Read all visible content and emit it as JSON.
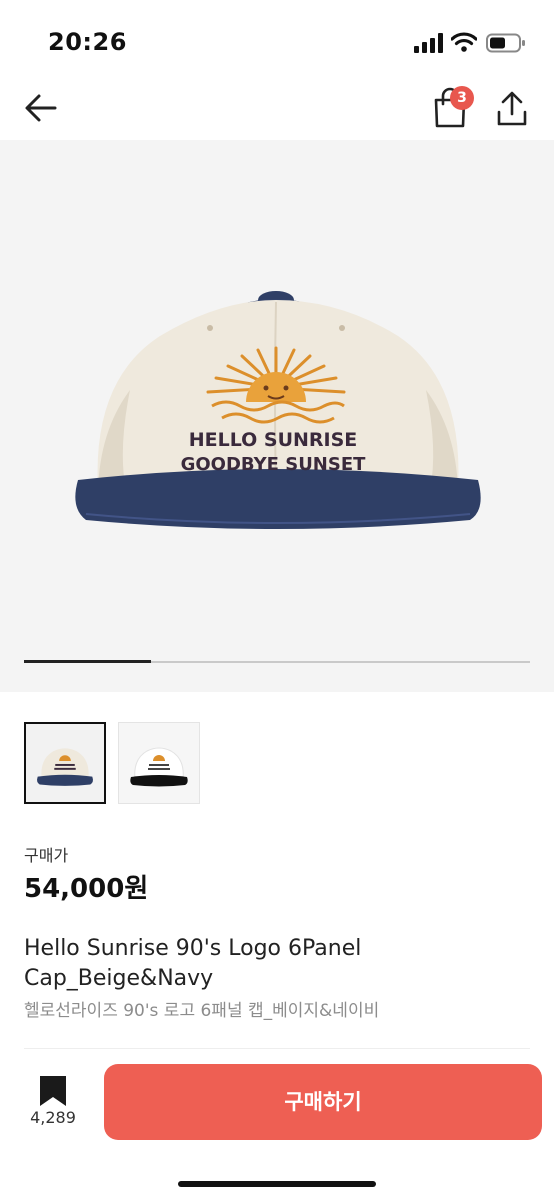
{
  "status_bar": {
    "time": "20:26"
  },
  "nav": {
    "cart_count": "3"
  },
  "hero": {
    "image_alt": "cap",
    "cap_text_line1": "HELLO SUNRISE",
    "cap_text_line2": "GOODBYE SUNSET",
    "carousel_progress": 0.25
  },
  "thumbnails": [
    {
      "name": "thumb-beige-navy",
      "selected": true
    },
    {
      "name": "thumb-white-black",
      "selected": false
    }
  ],
  "product": {
    "price_label": "구매가",
    "price": "54,000원",
    "title_en": "Hello Sunrise 90's Logo 6Panel Cap_Beige&Navy",
    "title_ko": "헬로선라이즈 90's 로고 6패널 캡_베이지&네이비"
  },
  "bottom": {
    "bookmark_count": "4,289",
    "buy_label": "구매하기"
  },
  "colors": {
    "accent": "#ee5f53",
    "badge": "#e8574e",
    "cap_crown": "#efe9dd",
    "cap_brim": "#2f3f66",
    "sun": "#dc8f2b",
    "embroidery_text": "#3a2a3c"
  }
}
